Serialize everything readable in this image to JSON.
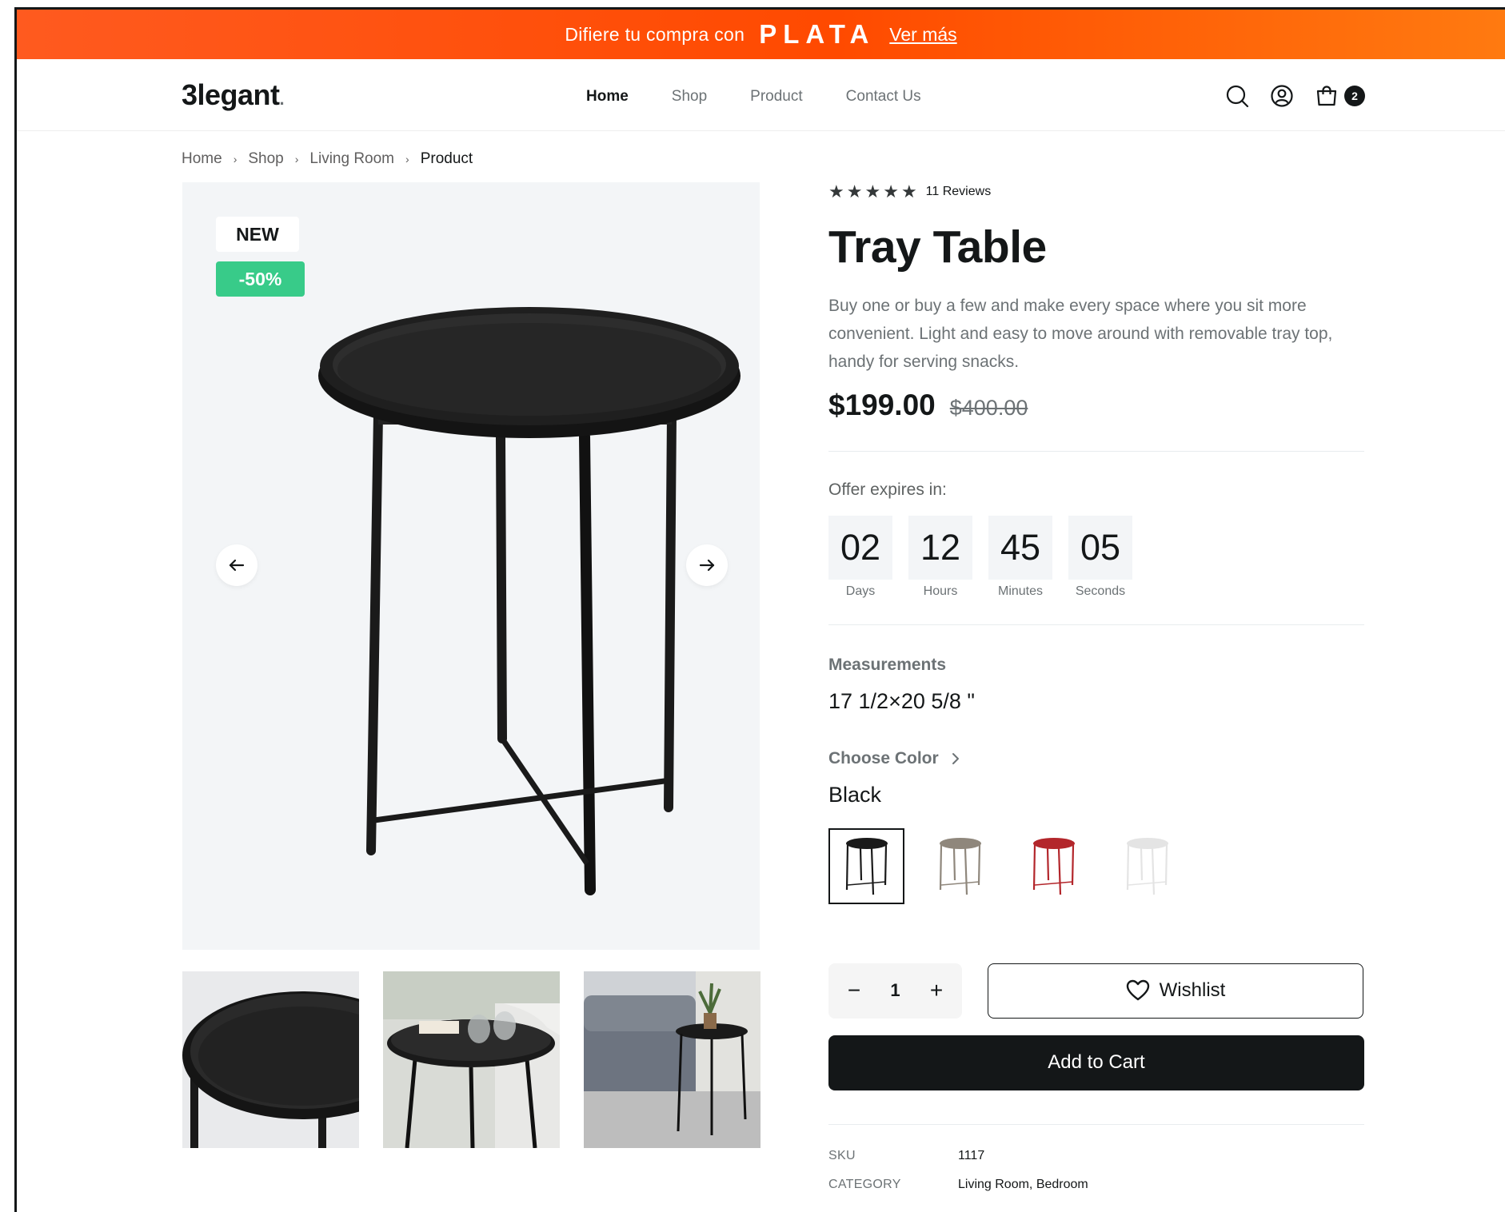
{
  "promo": {
    "text": "Difiere tu compra con",
    "brand": "PLATA",
    "link": "Ver más",
    "colors": {
      "start": "#ff5a1f",
      "end": "#ff7a10"
    }
  },
  "nav": {
    "logo": "3legant",
    "logo_dot": ".",
    "links": [
      {
        "label": "Home",
        "active": true
      },
      {
        "label": "Shop",
        "active": false
      },
      {
        "label": "Product",
        "active": false
      },
      {
        "label": "Contact Us",
        "active": false
      }
    ],
    "icons": [
      "search-icon",
      "user-icon",
      "shopping-bag-icon"
    ],
    "cart_count": "2"
  },
  "breadcrumb": {
    "items": [
      "Home",
      "Shop",
      "Living Room"
    ],
    "current": "Product",
    "separator": "›"
  },
  "gallery": {
    "tag_new": "NEW",
    "tag_discount": "-50%",
    "discount_color": "#38cb89",
    "prev_icon": "arrow-left-icon",
    "next_icon": "arrow-right-icon",
    "thumbnails": [
      "tray-top-closeup",
      "tray-with-glasses",
      "table-in-living-room"
    ]
  },
  "product": {
    "rating_stars": 5,
    "reviews": "11 Reviews",
    "title": "Tray Table",
    "description": "Buy one or buy a few and make every space where you sit more convenient. Light and easy to move around with removable tray top, handy for serving snacks.",
    "price": "$199.00",
    "old_price": "$400.00",
    "offer_label": "Offer expires in:",
    "countdown": [
      {
        "value": "02",
        "unit": "Days"
      },
      {
        "value": "12",
        "unit": "Hours"
      },
      {
        "value": "45",
        "unit": "Minutes"
      },
      {
        "value": "05",
        "unit": "Seconds"
      }
    ],
    "measurements_label": "Measurements",
    "measurements_value": "17 1/2×20 5/8 \"",
    "color_label": "Choose Color",
    "color_value": "Black",
    "swatches": [
      {
        "name": "Black",
        "color": "#1a1a1a",
        "selected": true
      },
      {
        "name": "Beige",
        "color": "#8f877c",
        "selected": false
      },
      {
        "name": "Red",
        "color": "#b3262b",
        "selected": false
      },
      {
        "name": "White",
        "color": "#e4e4e4",
        "selected": false
      }
    ],
    "quantity": "1",
    "wishlist_label": "Wishlist",
    "add_to_cart_label": "Add to Cart",
    "sku_label": "SKU",
    "sku_value": "1117",
    "category_label": "CATEGORY",
    "category_value": "Living Room, Bedroom"
  }
}
